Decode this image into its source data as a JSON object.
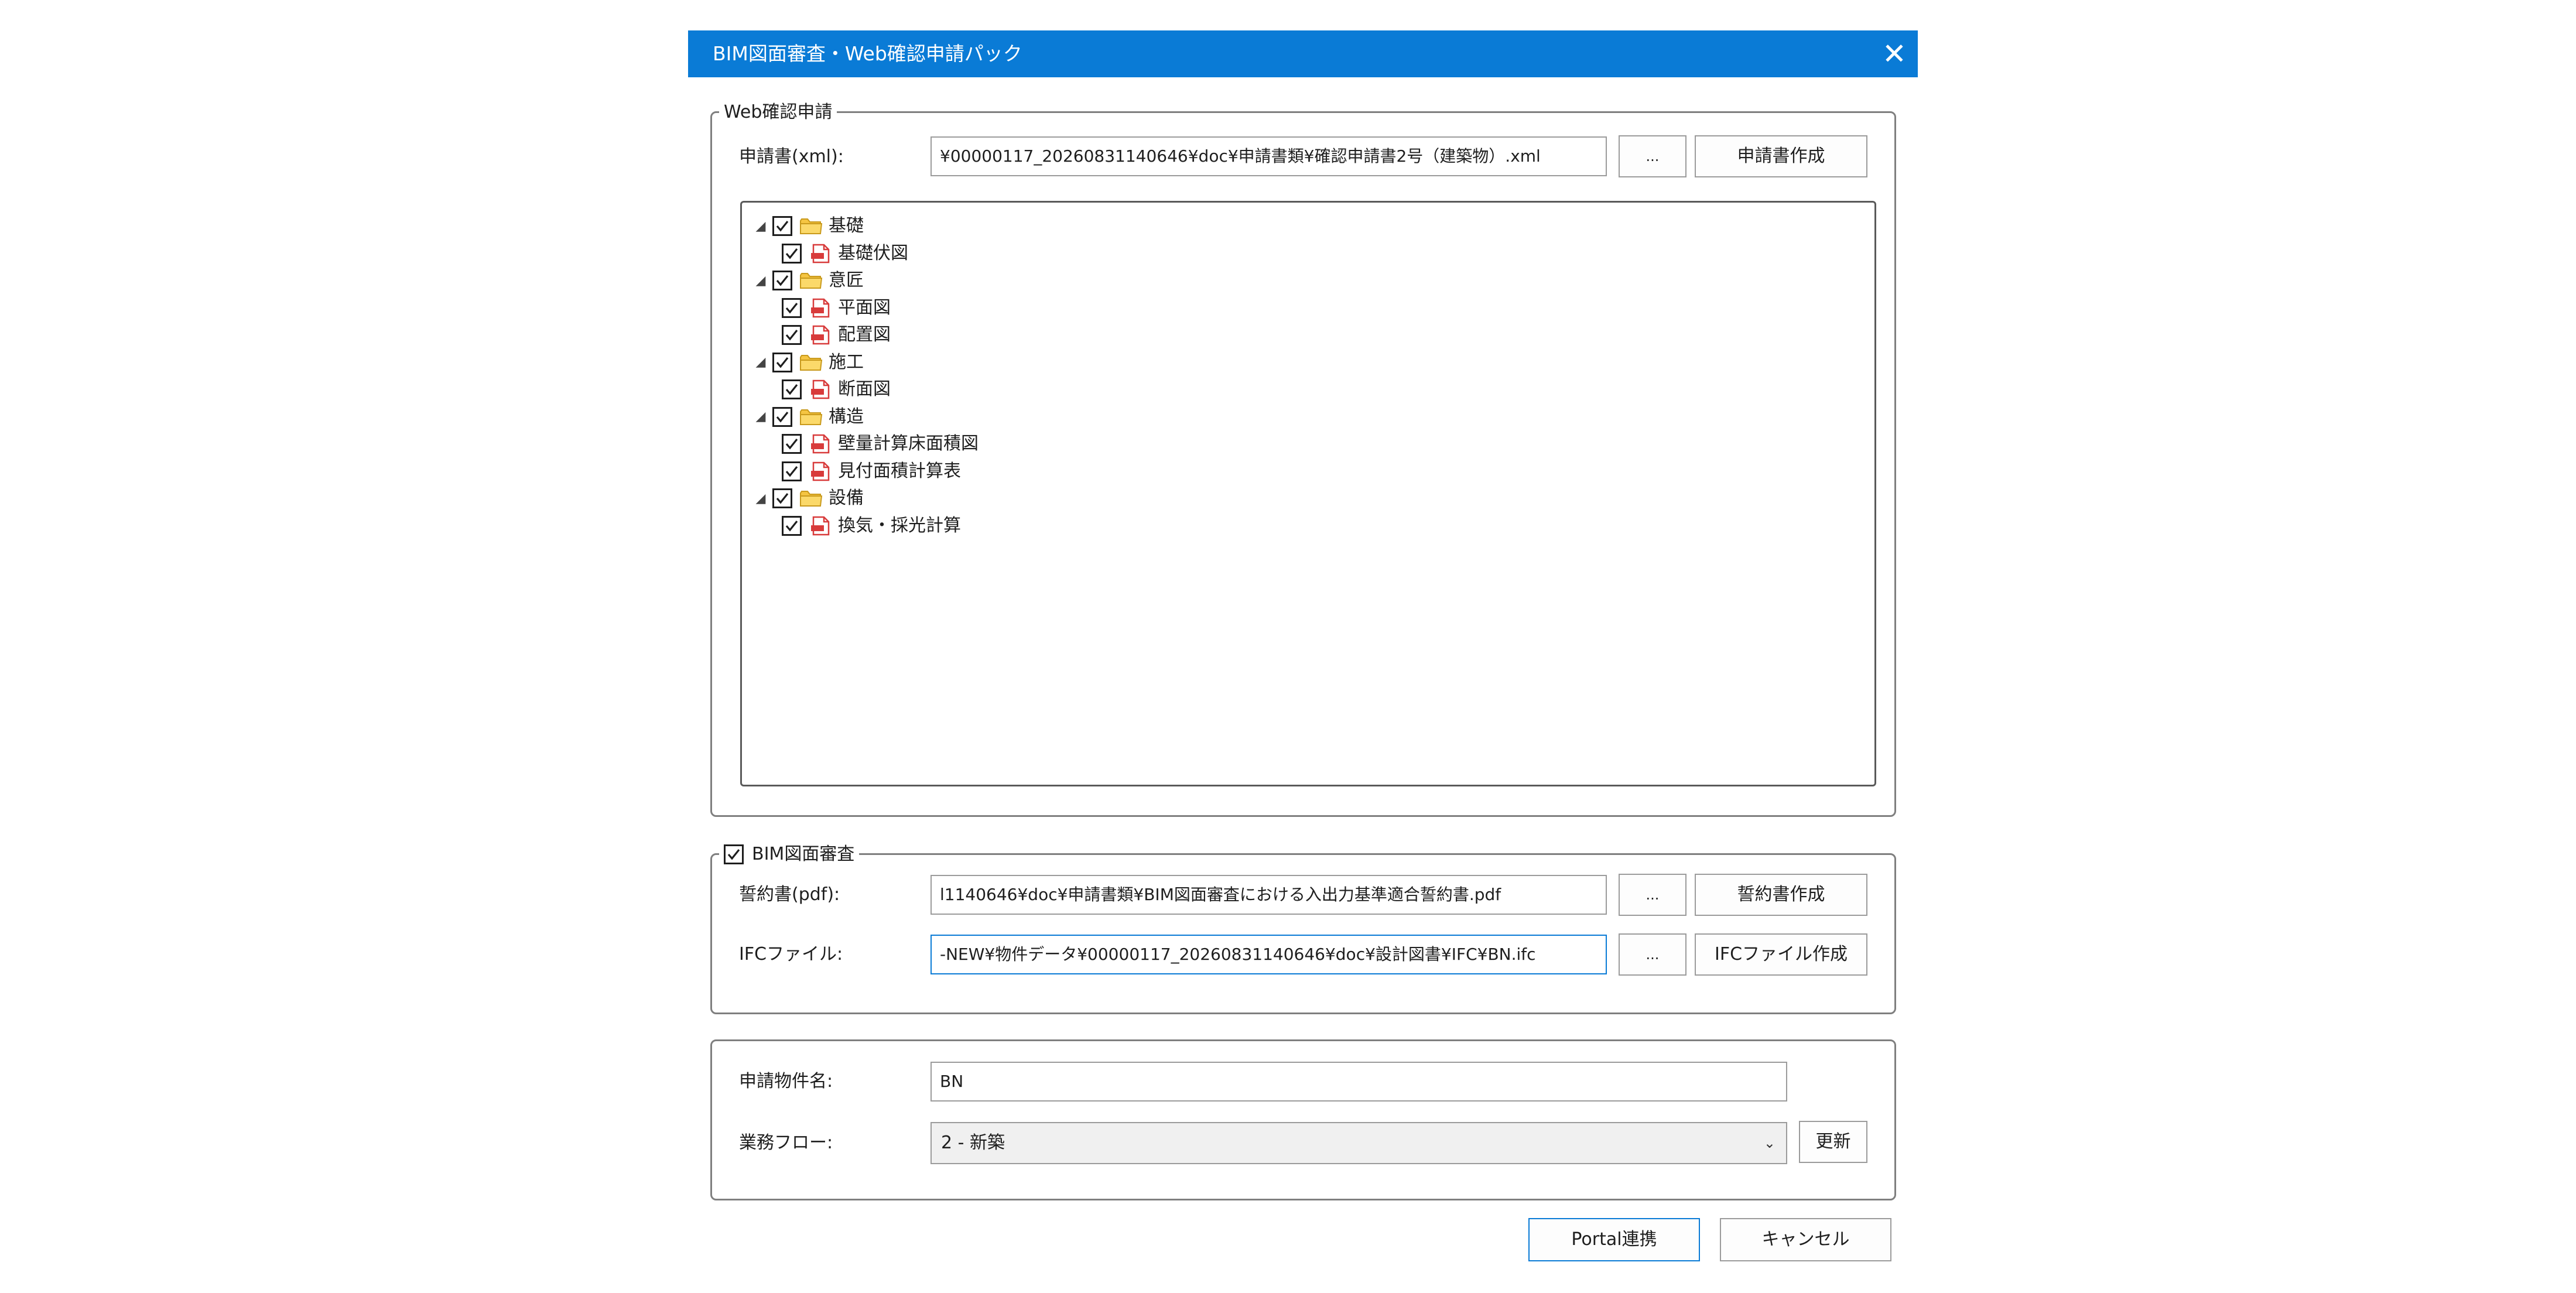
{
  "window": {
    "title": "BIM図面審査・Web確認申請パック",
    "close_glyph": "✕"
  },
  "web_group": {
    "legend": "Web確認申請",
    "xml_label": "申請書(xml):",
    "xml_value": "¥00000117_20260831140646¥doc¥申請書類¥確認申請書2号（建築物）.xml",
    "browse_label": "...",
    "create_label": "申請書作成",
    "tree": [
      {
        "label": "基礎",
        "checked": true,
        "children": [
          {
            "label": "基礎伏図",
            "checked": true
          }
        ]
      },
      {
        "label": "意匠",
        "checked": true,
        "children": [
          {
            "label": "平面図",
            "checked": true
          },
          {
            "label": "配置図",
            "checked": true
          }
        ]
      },
      {
        "label": "施工",
        "checked": true,
        "children": [
          {
            "label": "断面図",
            "checked": true
          }
        ]
      },
      {
        "label": "構造",
        "checked": true,
        "children": [
          {
            "label": "壁量計算床面積図",
            "checked": true
          },
          {
            "label": "見付面積計算表",
            "checked": true
          }
        ]
      },
      {
        "label": "設備",
        "checked": true,
        "children": [
          {
            "label": "換気・採光計算",
            "checked": true
          }
        ]
      }
    ]
  },
  "bim_group": {
    "legend": "BIM図面審査",
    "enabled": true,
    "pdf_label": "誓約書(pdf):",
    "pdf_value": "l1140646¥doc¥申請書類¥BIM図面審査における入出力基準適合誓約書.pdf",
    "pdf_browse_label": "...",
    "pdf_create_label": "誓約書作成",
    "ifc_label": "IFCファイル:",
    "ifc_value": "-NEW¥物件データ¥00000117_20260831140646¥doc¥設計図書¥IFC¥BN.ifc",
    "ifc_browse_label": "...",
    "ifc_create_label": "IFCファイル作成"
  },
  "project_group": {
    "name_label": "申請物件名:",
    "name_value": "BN",
    "flow_label": "業務フロー:",
    "flow_value": "2 - 新築",
    "refresh_label": "更新"
  },
  "footer": {
    "portal_label": "Portal連携",
    "cancel_label": "キャンセル"
  },
  "colors": {
    "titlebar": "#0a7bd6",
    "focus": "#0a7bd6",
    "folder": "#f5c542",
    "doc": "#d83b3b"
  },
  "icons": {
    "folder": "folder-icon",
    "document": "pdf-document-icon",
    "expander": "collapse-triangle-icon",
    "check": "check-icon"
  }
}
